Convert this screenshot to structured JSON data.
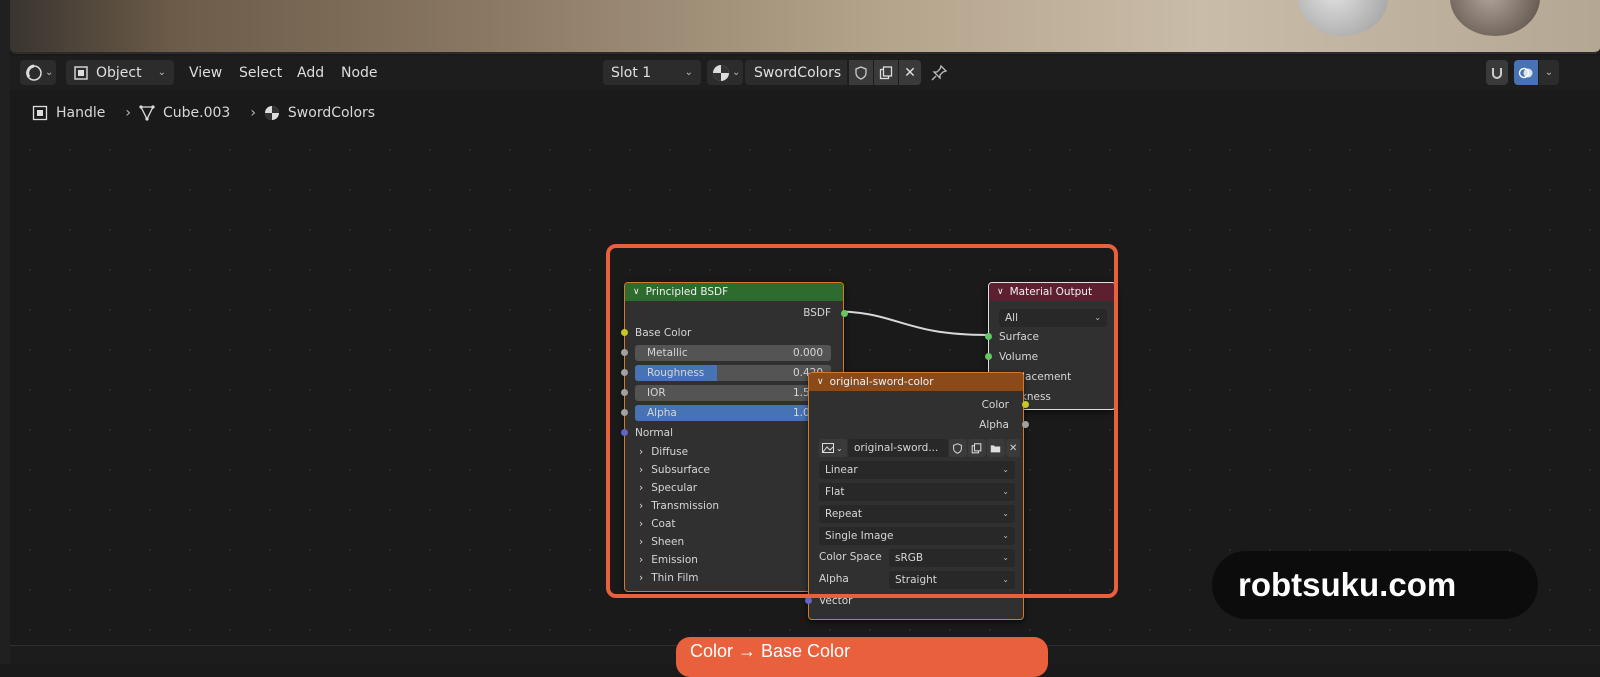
{
  "header": {
    "mode": "Object",
    "menus": [
      "View",
      "Select",
      "Add",
      "Node"
    ],
    "slot": "Slot 1",
    "material": "SwordColors"
  },
  "breadcrumb": [
    "Handle",
    "Cube.003",
    "SwordColors"
  ],
  "bsdf_node": {
    "title": "Principled BSDF",
    "output": "BSDF",
    "base_color": "Base Color",
    "fields": [
      {
        "label": "Metallic",
        "value": "0.000",
        "fill": 0
      },
      {
        "label": "Roughness",
        "value": "0.420",
        "fill": 0.42
      },
      {
        "label": "IOR",
        "value": "1.500",
        "fill": 0
      },
      {
        "label": "Alpha",
        "value": "1.000",
        "fill": 1.0
      }
    ],
    "normal": "Normal",
    "panels": [
      "Diffuse",
      "Subsurface",
      "Specular",
      "Transmission",
      "Coat",
      "Sheen",
      "Emission",
      "Thin Film"
    ]
  },
  "output_node": {
    "title": "Material Output",
    "target": "All",
    "inputs": [
      "Surface",
      "Volume",
      "Displacement",
      "Thickness"
    ]
  },
  "image_node": {
    "title": "original-sword-color",
    "outputs": [
      "Color",
      "Alpha"
    ],
    "image_name": "original-sword...",
    "interpolation": "Linear",
    "projection": "Flat",
    "extension": "Repeat",
    "source": "Single Image",
    "color_space_label": "Color Space",
    "color_space": "sRGB",
    "alpha_label": "Alpha",
    "alpha_mode": "Straight",
    "vector": "Vector"
  },
  "watermark": "robtsuku.com",
  "caption": "Color → Base Color",
  "colors": {
    "accent": "#e8603c",
    "bsdf_header": "#2e6b2e",
    "texture_header": "#8a4a1a",
    "output_header": "#5c2030",
    "selected": "#4772b3"
  }
}
